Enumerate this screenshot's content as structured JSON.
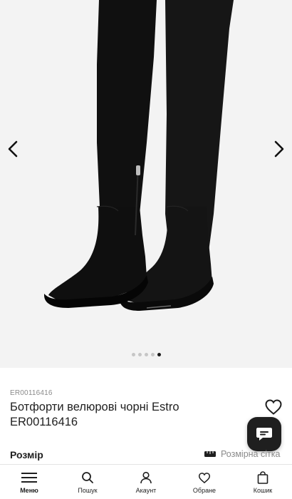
{
  "gallery": {
    "image_name": "boot-photo",
    "slide_count": 5,
    "active_slide": 5,
    "prev_icon": "chevron-left-icon",
    "next_icon": "chevron-right-icon"
  },
  "product": {
    "sku": "ER00116416",
    "title": "Ботфорти велюрові чорні Estro ER00116416",
    "wishlist_icon": "heart-icon",
    "chat_icon": "chat-bubble-icon"
  },
  "sizes": {
    "label": "Розмір",
    "chart_label": "Розмірна сітка",
    "chart_icon": "ruler-icon"
  },
  "bottom_nav": {
    "menu": "Меню",
    "search": "Пошук",
    "account": "Акаунт",
    "favorites": "Обране",
    "cart": "Кошик"
  },
  "colors": {
    "accent": "#1f1f1f",
    "gallery_bg": "#f3f3f3",
    "muted_text": "#8a8a8a"
  }
}
